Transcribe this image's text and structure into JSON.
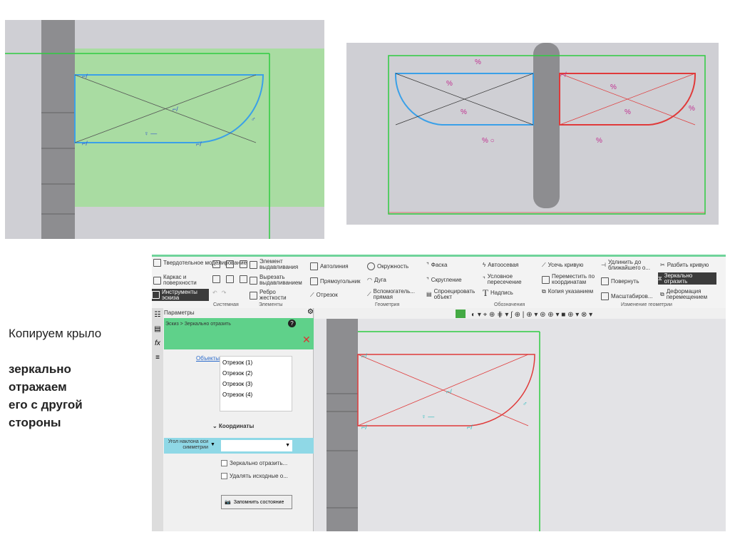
{
  "caption": {
    "line1": "Копируем крыло",
    "line2": "зеркально",
    "line3": "отражаем",
    "line4": "его с другой",
    "line5": "стороны"
  },
  "toolbar": {
    "modes": [
      "Твердотельное моделирование",
      "Каркас и поверхности",
      "Инструменты эскиза"
    ],
    "system_label": "Системная",
    "elements": [
      "Элемент выдавливания",
      "Вырезать выдавливанием",
      "Ребро жесткости"
    ],
    "elements_label": "Элементы",
    "geometry": [
      "Автолиния",
      "Окружность",
      "Фаска",
      "Прямоугольник",
      "Дуга",
      "Скругление",
      "Отрезок",
      "Вспомогатель... прямая",
      "Спроецировать объект"
    ],
    "geometry_label": "Геометрия",
    "annotations": [
      "Автоосевая",
      "Условное пересечение",
      "Надпись"
    ],
    "annotations_label": "Обозначения",
    "edit": [
      "Усечь кривую",
      "Удлинить до ближайшего о...",
      "Разбить кривую",
      "Переместить по координатам",
      "Повернуть",
      "Зеркально отразить",
      "Копия указанием",
      "Масштабиров...",
      "Деформация перемещением"
    ],
    "edit_label": "Изменение геометрии"
  },
  "panel": {
    "title": "Параметры",
    "breadcrumb": "Эскиз > Зеркально отразить",
    "objects_label": "Объекты",
    "objects": [
      "Отрезок (1)",
      "Отрезок (2)",
      "Отрезок (3)",
      "Отрезок (4)"
    ],
    "section": "Координаты",
    "axis_label": "Угол наклона оси симметрии",
    "axis_value": "",
    "check1": "Зеркально отразить...",
    "check2": "Удалять исходные о...",
    "save_state": "Запомнить состояние"
  },
  "colors": {
    "accent": "#5fd18a",
    "selection": "#3a3a3a"
  }
}
